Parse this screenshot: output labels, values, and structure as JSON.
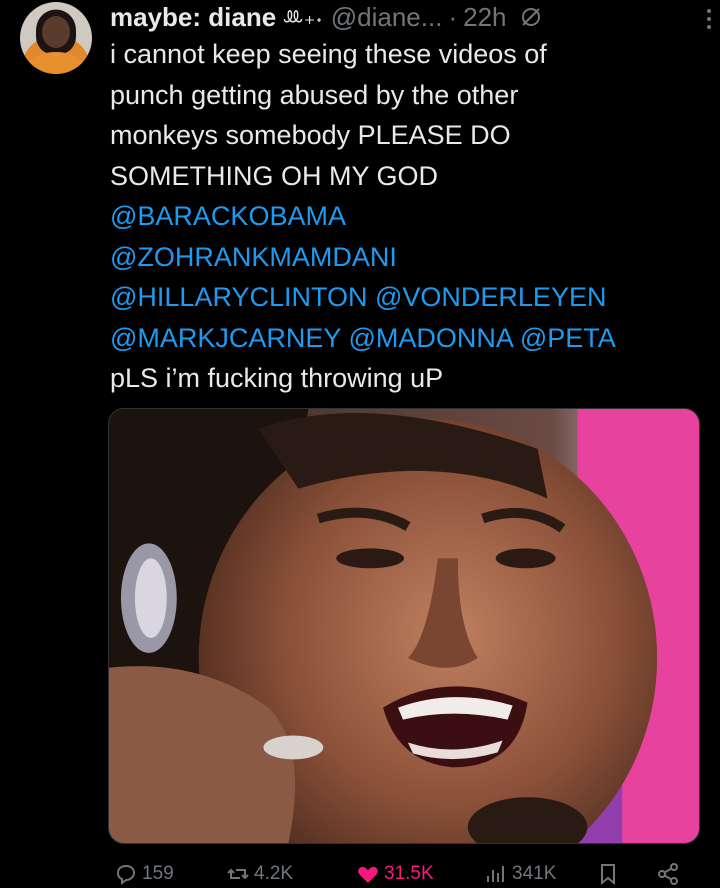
{
  "post": {
    "display_name": "maybe: diane",
    "name_decoration": "ꔛ₊˖",
    "handle": "@diane...",
    "separator": "·",
    "time": "22h",
    "text_lines": [
      {
        "text": "i cannot keep seeing these videos of",
        "mention": false
      },
      {
        "text": "punch getting abused by the other",
        "mention": false
      },
      {
        "text": "monkeys somebody PLEASE DO",
        "mention": false
      },
      {
        "text": "SOMETHING OH MY GOD",
        "mention": false
      },
      {
        "text": "@BARACKOBAMA",
        "mention": true
      },
      {
        "text": "@ZOHRANKMAMDANI",
        "mention": true
      },
      {
        "text": "@HILLARYCLINTON @VONDERLEYEN",
        "mention": true
      },
      {
        "text": "@MARKJCARNEY @MADONNA @PETA",
        "mention": true
      },
      {
        "text": "pLS i’m fucking throwing uP",
        "mention": false
      }
    ]
  },
  "actions": {
    "replies": "159",
    "reposts": "4.2K",
    "likes": "31.5K",
    "views": "341K"
  },
  "icons": [
    "grok-icon",
    "more-icon",
    "reply-icon",
    "repost-icon",
    "like-icon",
    "views-icon",
    "bookmark-icon",
    "share-icon"
  ],
  "colors": {
    "background": "#000000",
    "text": "#e7e9ea",
    "muted": "#71767b",
    "mention": "#1d9bf0",
    "like": "#f91880"
  }
}
